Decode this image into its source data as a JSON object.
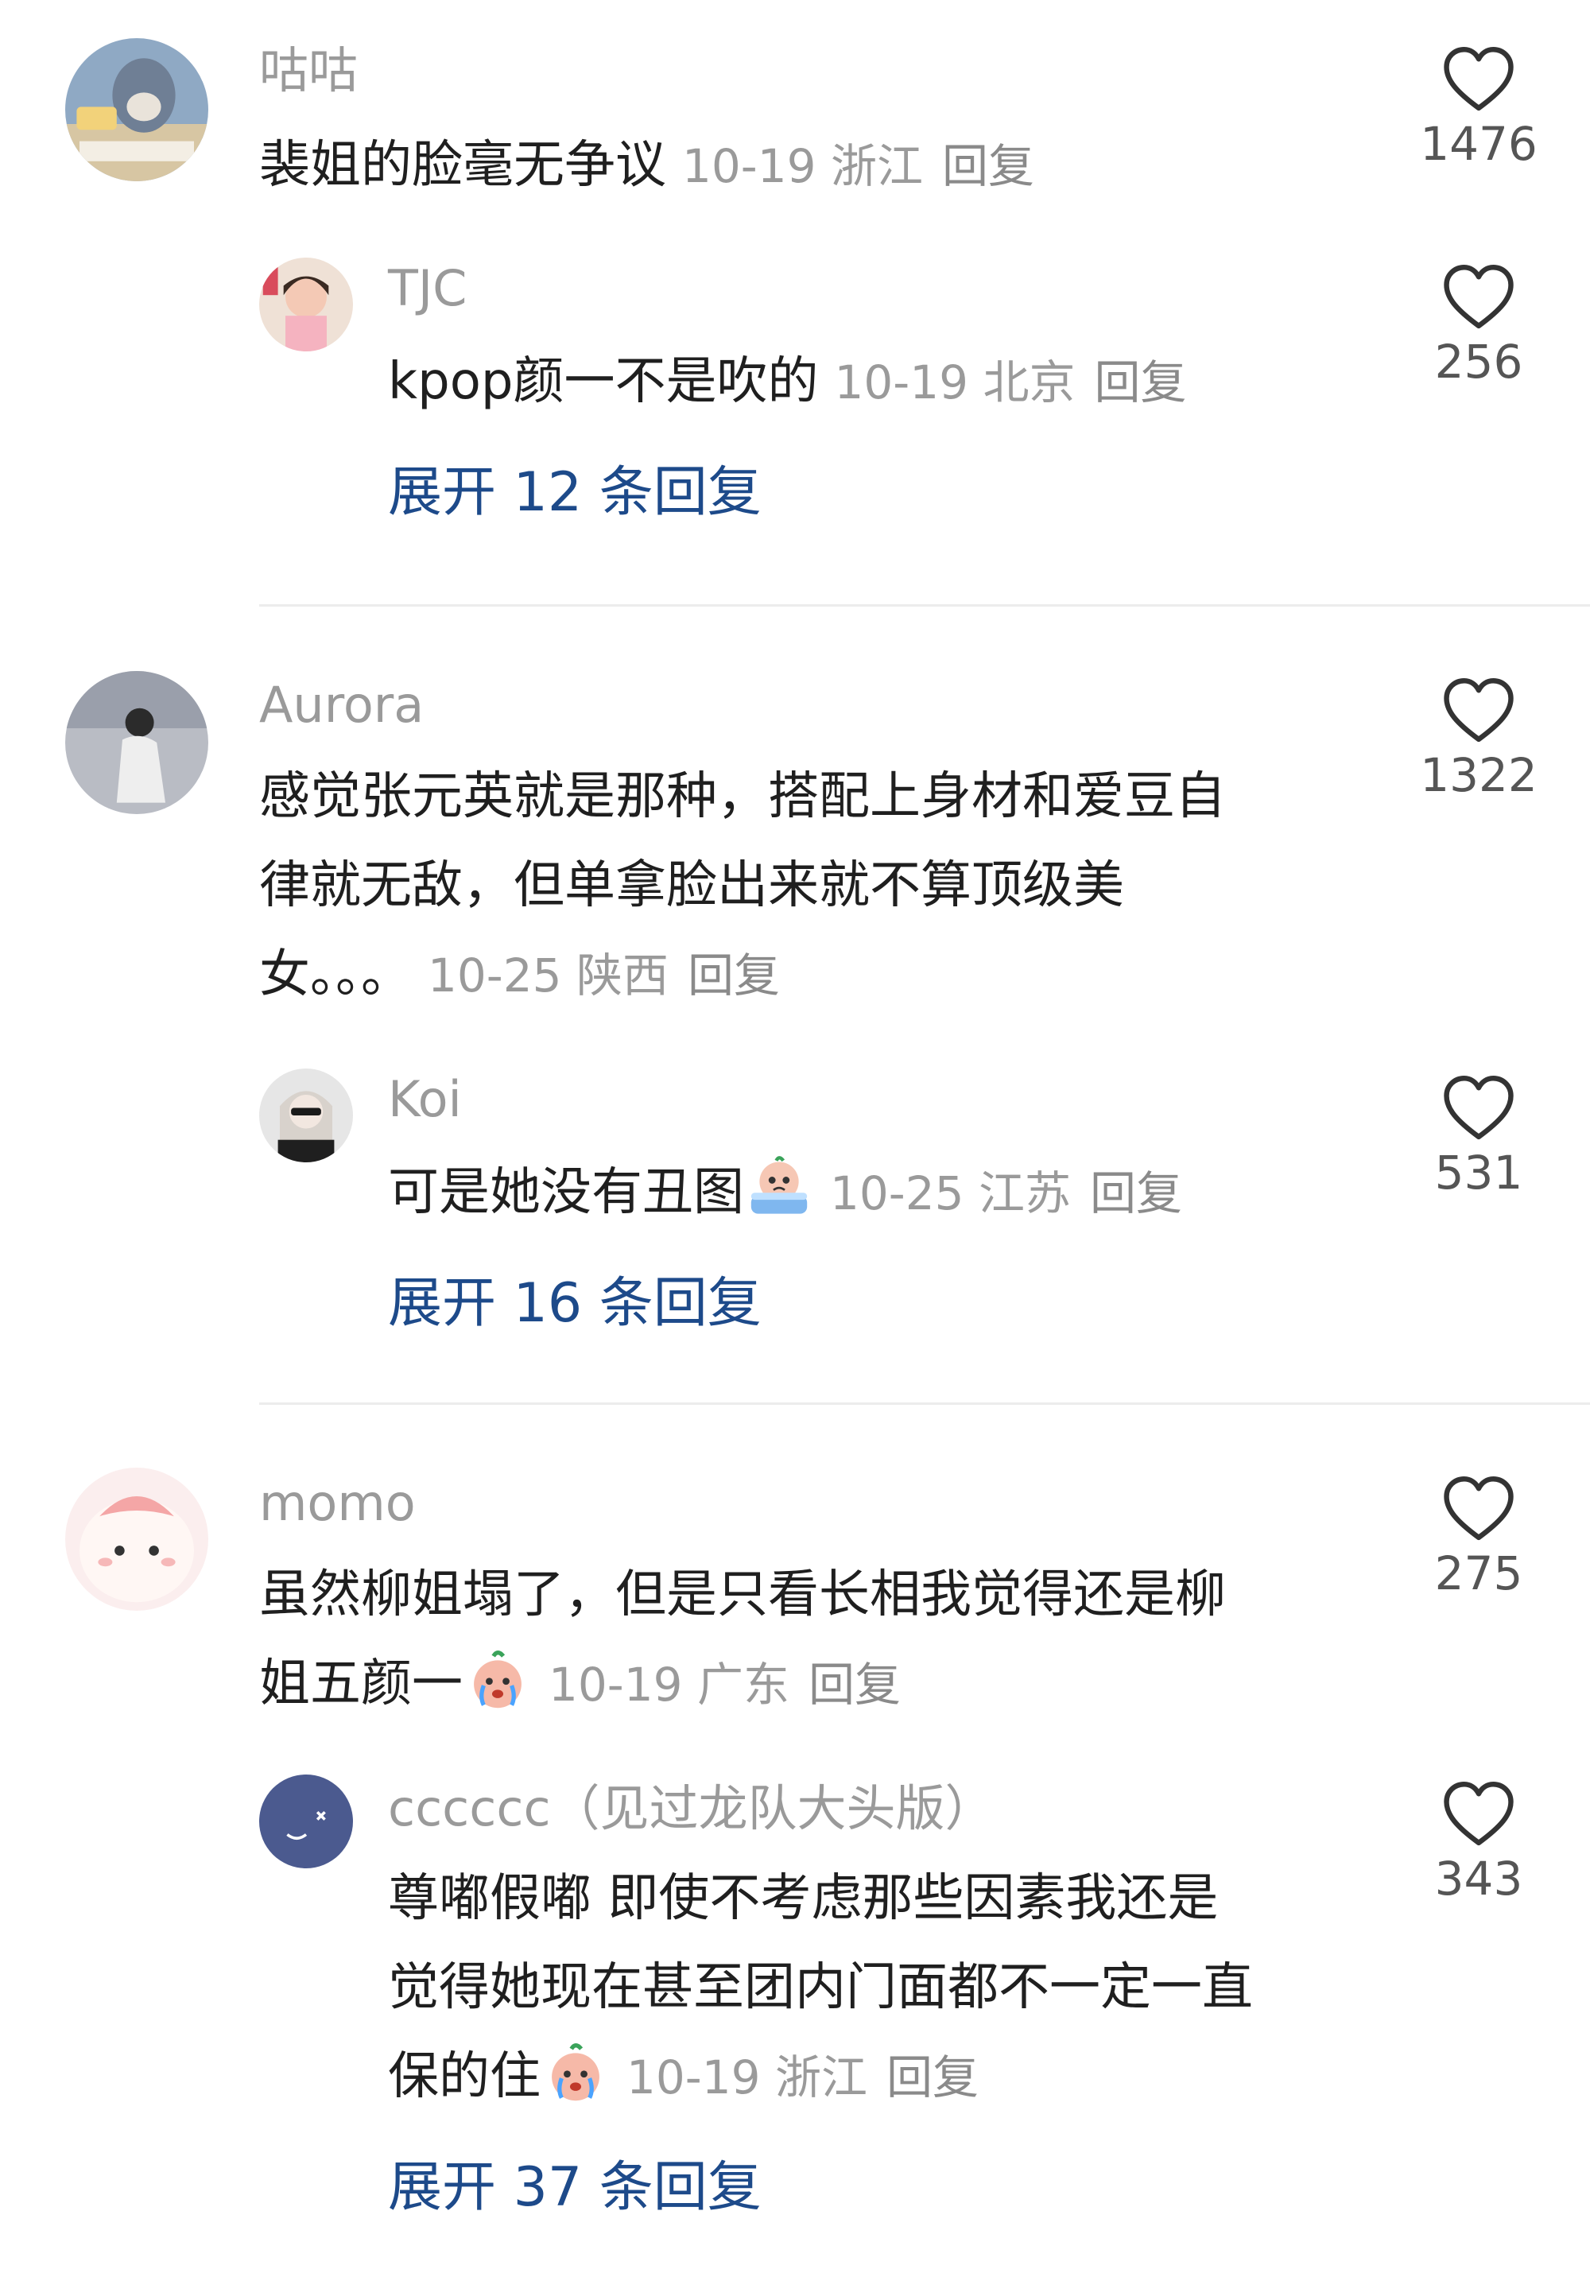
{
  "comments": [
    {
      "user": "咕咕",
      "text": "裴姐的脸毫无争议",
      "date": "10-19",
      "location": "浙江",
      "reply_label": "回复",
      "likes": "1476",
      "reply": {
        "user": "TJC",
        "text": "kpop颜一不是吹的",
        "date": "10-19",
        "location": "北京",
        "reply_label": "回复",
        "likes": "256"
      },
      "expand": "展开 12 条回复"
    },
    {
      "user": "Aurora",
      "text_lines": [
        "感觉张元英就是那种，搭配上身材和爱豆自",
        "律就无敌，但单拿脸出来就不算顶级美",
        "女。。。"
      ],
      "date": "10-25",
      "location": "陕西",
      "reply_label": "回复",
      "likes": "1322",
      "reply": {
        "user": "Koi",
        "text": "可是她没有丑图",
        "date": "10-25",
        "location": "江苏",
        "reply_label": "回复",
        "likes": "531"
      },
      "expand": "展开 16 条回复"
    },
    {
      "user": "momo",
      "text_lines": [
        "虽然柳姐塌了，但是只看长相我觉得还是柳",
        "姐五颜一"
      ],
      "date": "10-19",
      "location": "广东",
      "reply_label": "回复",
      "likes": "275",
      "reply": {
        "user": "cccccc（见过龙队大头版）",
        "text_lines": [
          "尊嘟假嘟 即使不考虑那些因素我还是",
          "觉得她现在甚至团内门面都不一定一直",
          "保的住"
        ],
        "date": "10-19",
        "location": "浙江",
        "reply_label": "回复",
        "likes": "343"
      },
      "expand": "展开 37 条回复"
    }
  ],
  "icons": {
    "like": "heart-outline-icon",
    "emoji_crying": "crying-emoji-icon",
    "emoji_bathtub": "bathtub-crying-emoji-icon"
  },
  "colors": {
    "username": "#9a9a9a",
    "text": "#1f1f1f",
    "meta": "#9a9a9a",
    "expand_link": "#1d4a8a",
    "divider": "#ececec"
  }
}
